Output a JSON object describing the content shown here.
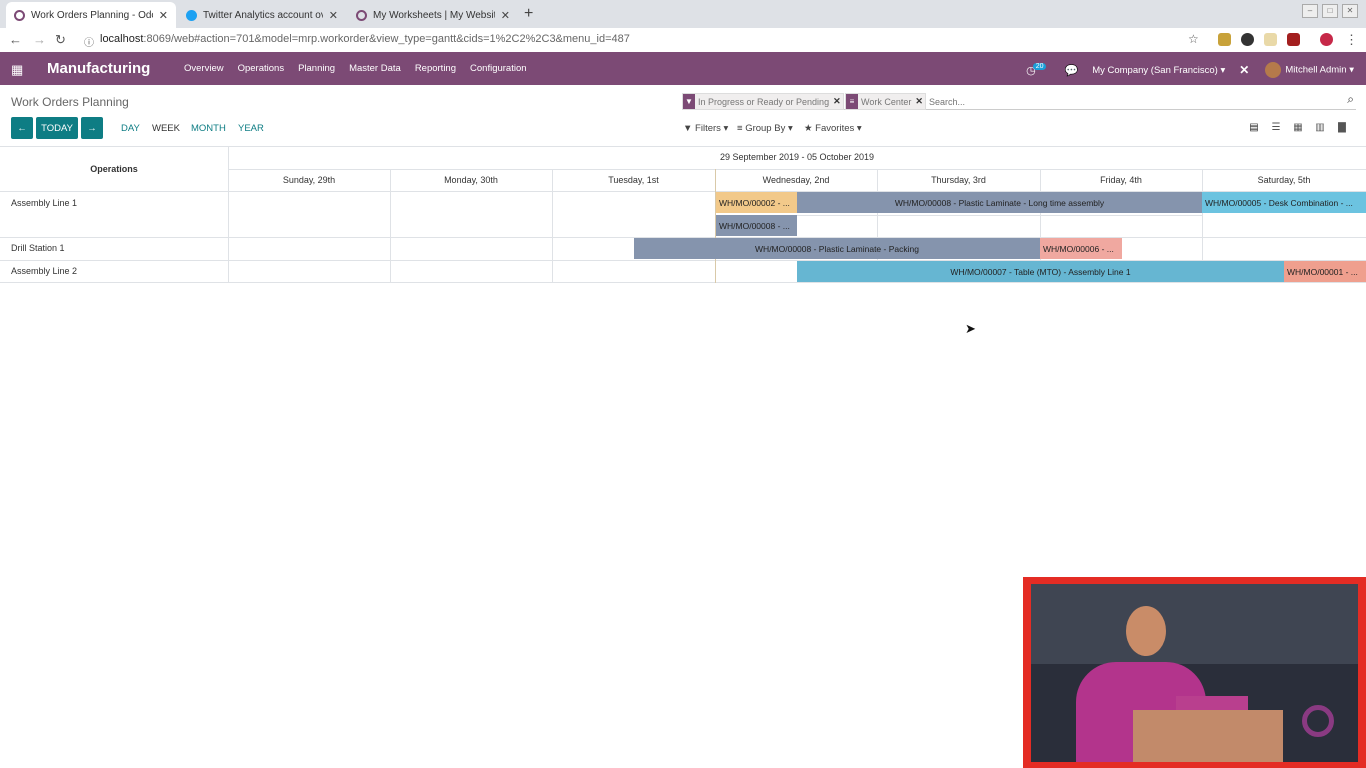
{
  "browser": {
    "tabs": [
      {
        "title": "Work Orders Planning - Odoo",
        "active": true,
        "icon": "odoo-icon",
        "color": "#7c4a75"
      },
      {
        "title": "Twitter Analytics account ov",
        "active": false,
        "icon": "twitter-icon",
        "color": "#1da1f2"
      },
      {
        "title": "My Worksheets | My Website",
        "active": false,
        "icon": "odoo-icon",
        "color": "#7c4a75"
      }
    ],
    "url_host": "localhost",
    "url_rest": ":8069/web#action=701&model=mrp.workorder&view_type=gantt&cids=1%2C2%2C3&menu_id=487"
  },
  "navbar": {
    "app_name": "Manufacturing",
    "menu": [
      "Overview",
      "Operations",
      "Planning",
      "Master Data",
      "Reporting",
      "Configuration"
    ],
    "activity_count": "20",
    "company": "My Company (San Francisco)",
    "user": "Mitchell Admin",
    "color": "#7c4a75"
  },
  "control_panel": {
    "title": "Work Orders Planning",
    "facets": [
      "In Progress or Ready or Pending",
      "Work Center"
    ],
    "search_placeholder": "Search...",
    "today_label": "TODAY",
    "scales": [
      "DAY",
      "WEEK",
      "MONTH",
      "YEAR"
    ],
    "selected_scale": "WEEK",
    "filters_label": "Filters",
    "groupby_label": "Group By",
    "favorites_label": "Favorites",
    "accent": "#0e7d84"
  },
  "gantt": {
    "ops_header": "Operations",
    "range_label": "29 September 2019 - 05 October 2019",
    "days": [
      "Sunday, 29th",
      "Monday, 30th",
      "Tuesday, 1st",
      "Wednesday, 2nd",
      "Thursday, 3rd",
      "Friday, 4th",
      "Saturday, 5th"
    ],
    "rows": [
      {
        "label": "Assembly Line 1"
      },
      {
        "label": "Drill Station 1"
      },
      {
        "label": "Assembly Line 2"
      }
    ],
    "pills": [
      {
        "label": "WH/MO/00002 - ...",
        "color": "#f2c98a"
      },
      {
        "label": "WH/MO/00008 - Plastic Laminate - Long time assembly",
        "color": "#8594ad"
      },
      {
        "label": "WH/MO/00005 - Desk Combination - ...",
        "color": "#6cc3e0"
      },
      {
        "label": "WH/MO/00008 - ...",
        "color": "#8594ad"
      },
      {
        "label": "WH/MO/00008 - Plastic Laminate - Packing",
        "color": "#8594ad"
      },
      {
        "label": "WH/MO/00006 - ...",
        "color": "#f0a8a0"
      },
      {
        "label": "WH/MO/00007 - Table (MTO) - Assembly Line 1",
        "color": "#66b6d2"
      },
      {
        "label": "WH/MO/00001 - ...",
        "color": "#ef9f8e"
      }
    ]
  }
}
